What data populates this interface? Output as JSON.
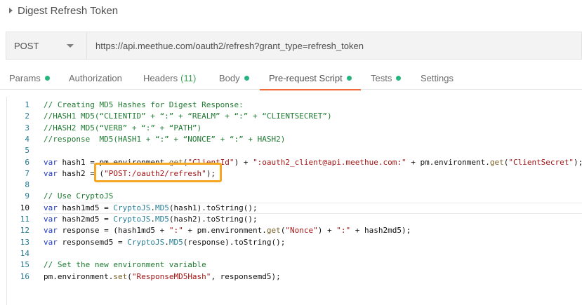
{
  "request": {
    "title": "Digest Refresh Token",
    "method": "POST",
    "url": "https://api.meethue.com/oauth2/refresh?grant_type=refresh_token"
  },
  "tabs": [
    {
      "label": "Params",
      "count": "",
      "dot": true
    },
    {
      "label": "Authorization",
      "count": "",
      "dot": false
    },
    {
      "label": "Headers",
      "count": "(11)",
      "dot": false
    },
    {
      "label": "Body",
      "count": "",
      "dot": true
    },
    {
      "label": "Pre-request Script",
      "count": "",
      "dot": true,
      "active": true
    },
    {
      "label": "Tests",
      "count": "",
      "dot": true
    },
    {
      "label": "Settings",
      "count": "",
      "dot": false
    }
  ],
  "editor": {
    "current_line": 10,
    "lines": [
      {
        "n": "1",
        "tokens": [
          {
            "t": "// Creating MD5 Hashes for Digest Response:",
            "c": "comment"
          }
        ]
      },
      {
        "n": "2",
        "tokens": [
          {
            "t": "//HASH1 MD5(“CLIENTID” + “:” + “REALM” + “:” + “CLIENTSECRET”)",
            "c": "comment"
          }
        ]
      },
      {
        "n": "3",
        "tokens": [
          {
            "t": "//HASH2 MD5(“VERB” + “:” + “PATH”)",
            "c": "comment"
          }
        ]
      },
      {
        "n": "4",
        "tokens": [
          {
            "t": "//response  MD5(HASH1 + “:” + “NONCE” + “:” + HASH2)",
            "c": "comment"
          }
        ]
      },
      {
        "n": "5",
        "tokens": []
      },
      {
        "n": "6",
        "tokens": [
          {
            "t": "var",
            "c": "kw"
          },
          {
            "t": " hash1 = pm.environment.",
            "c": "plain"
          },
          {
            "t": "get",
            "c": "fn"
          },
          {
            "t": "(",
            "c": "plain"
          },
          {
            "t": "\"ClientId\"",
            "c": "str"
          },
          {
            "t": ") + ",
            "c": "plain"
          },
          {
            "t": "\":oauth2_client@api.meethue.com:\"",
            "c": "str"
          },
          {
            "t": " + pm.environment.",
            "c": "plain"
          },
          {
            "t": "get",
            "c": "fn"
          },
          {
            "t": "(",
            "c": "plain"
          },
          {
            "t": "\"ClientSecret\"",
            "c": "str"
          },
          {
            "t": ");",
            "c": "plain"
          }
        ]
      },
      {
        "n": "7",
        "tokens": [
          {
            "t": "var",
            "c": "kw"
          },
          {
            "t": " hash2 = (",
            "c": "plain"
          },
          {
            "t": "\"POST:/oauth2/refresh\"",
            "c": "str"
          },
          {
            "t": ");",
            "c": "plain"
          }
        ]
      },
      {
        "n": "8",
        "tokens": []
      },
      {
        "n": "9",
        "tokens": [
          {
            "t": "// Use CryptoJS",
            "c": "comment"
          }
        ]
      },
      {
        "n": "10",
        "tokens": [
          {
            "t": "var",
            "c": "kw"
          },
          {
            "t": " hash1md5 = ",
            "c": "plain"
          },
          {
            "t": "CryptoJS",
            "c": "obj"
          },
          {
            "t": ".",
            "c": "plain"
          },
          {
            "t": "MD5",
            "c": "obj"
          },
          {
            "t": "(hash1).toString();",
            "c": "plain"
          }
        ]
      },
      {
        "n": "11",
        "tokens": [
          {
            "t": "var",
            "c": "kw"
          },
          {
            "t": " hash2md5 = ",
            "c": "plain"
          },
          {
            "t": "CryptoJS",
            "c": "obj"
          },
          {
            "t": ".",
            "c": "plain"
          },
          {
            "t": "MD5",
            "c": "obj"
          },
          {
            "t": "(hash2).toString();",
            "c": "plain"
          }
        ]
      },
      {
        "n": "12",
        "tokens": [
          {
            "t": "var",
            "c": "kw"
          },
          {
            "t": " response = (hash1md5 + ",
            "c": "plain"
          },
          {
            "t": "\":\"",
            "c": "str"
          },
          {
            "t": " + pm.environment.",
            "c": "plain"
          },
          {
            "t": "get",
            "c": "fn"
          },
          {
            "t": "(",
            "c": "plain"
          },
          {
            "t": "\"Nonce\"",
            "c": "str"
          },
          {
            "t": ") + ",
            "c": "plain"
          },
          {
            "t": "\":\"",
            "c": "str"
          },
          {
            "t": " + hash2md5);",
            "c": "plain"
          }
        ]
      },
      {
        "n": "13",
        "tokens": [
          {
            "t": "var",
            "c": "kw"
          },
          {
            "t": " responsemd5 = ",
            "c": "plain"
          },
          {
            "t": "CryptoJS",
            "c": "obj"
          },
          {
            "t": ".",
            "c": "plain"
          },
          {
            "t": "MD5",
            "c": "obj"
          },
          {
            "t": "(response).toString();",
            "c": "plain"
          }
        ]
      },
      {
        "n": "14",
        "tokens": []
      },
      {
        "n": "15",
        "tokens": [
          {
            "t": "// Set the new environment variable",
            "c": "comment"
          }
        ]
      },
      {
        "n": "16",
        "tokens": [
          {
            "t": "pm.environment.",
            "c": "plain"
          },
          {
            "t": "set",
            "c": "fn"
          },
          {
            "t": "(",
            "c": "plain"
          },
          {
            "t": "\"ResponseMD5Hash\"",
            "c": "str"
          },
          {
            "t": ", responsemd5);",
            "c": "plain"
          }
        ]
      }
    ]
  },
  "colors": {
    "accent": "#f26b3a",
    "dot": "#26b47f",
    "highlight_border": "#f5a623"
  }
}
